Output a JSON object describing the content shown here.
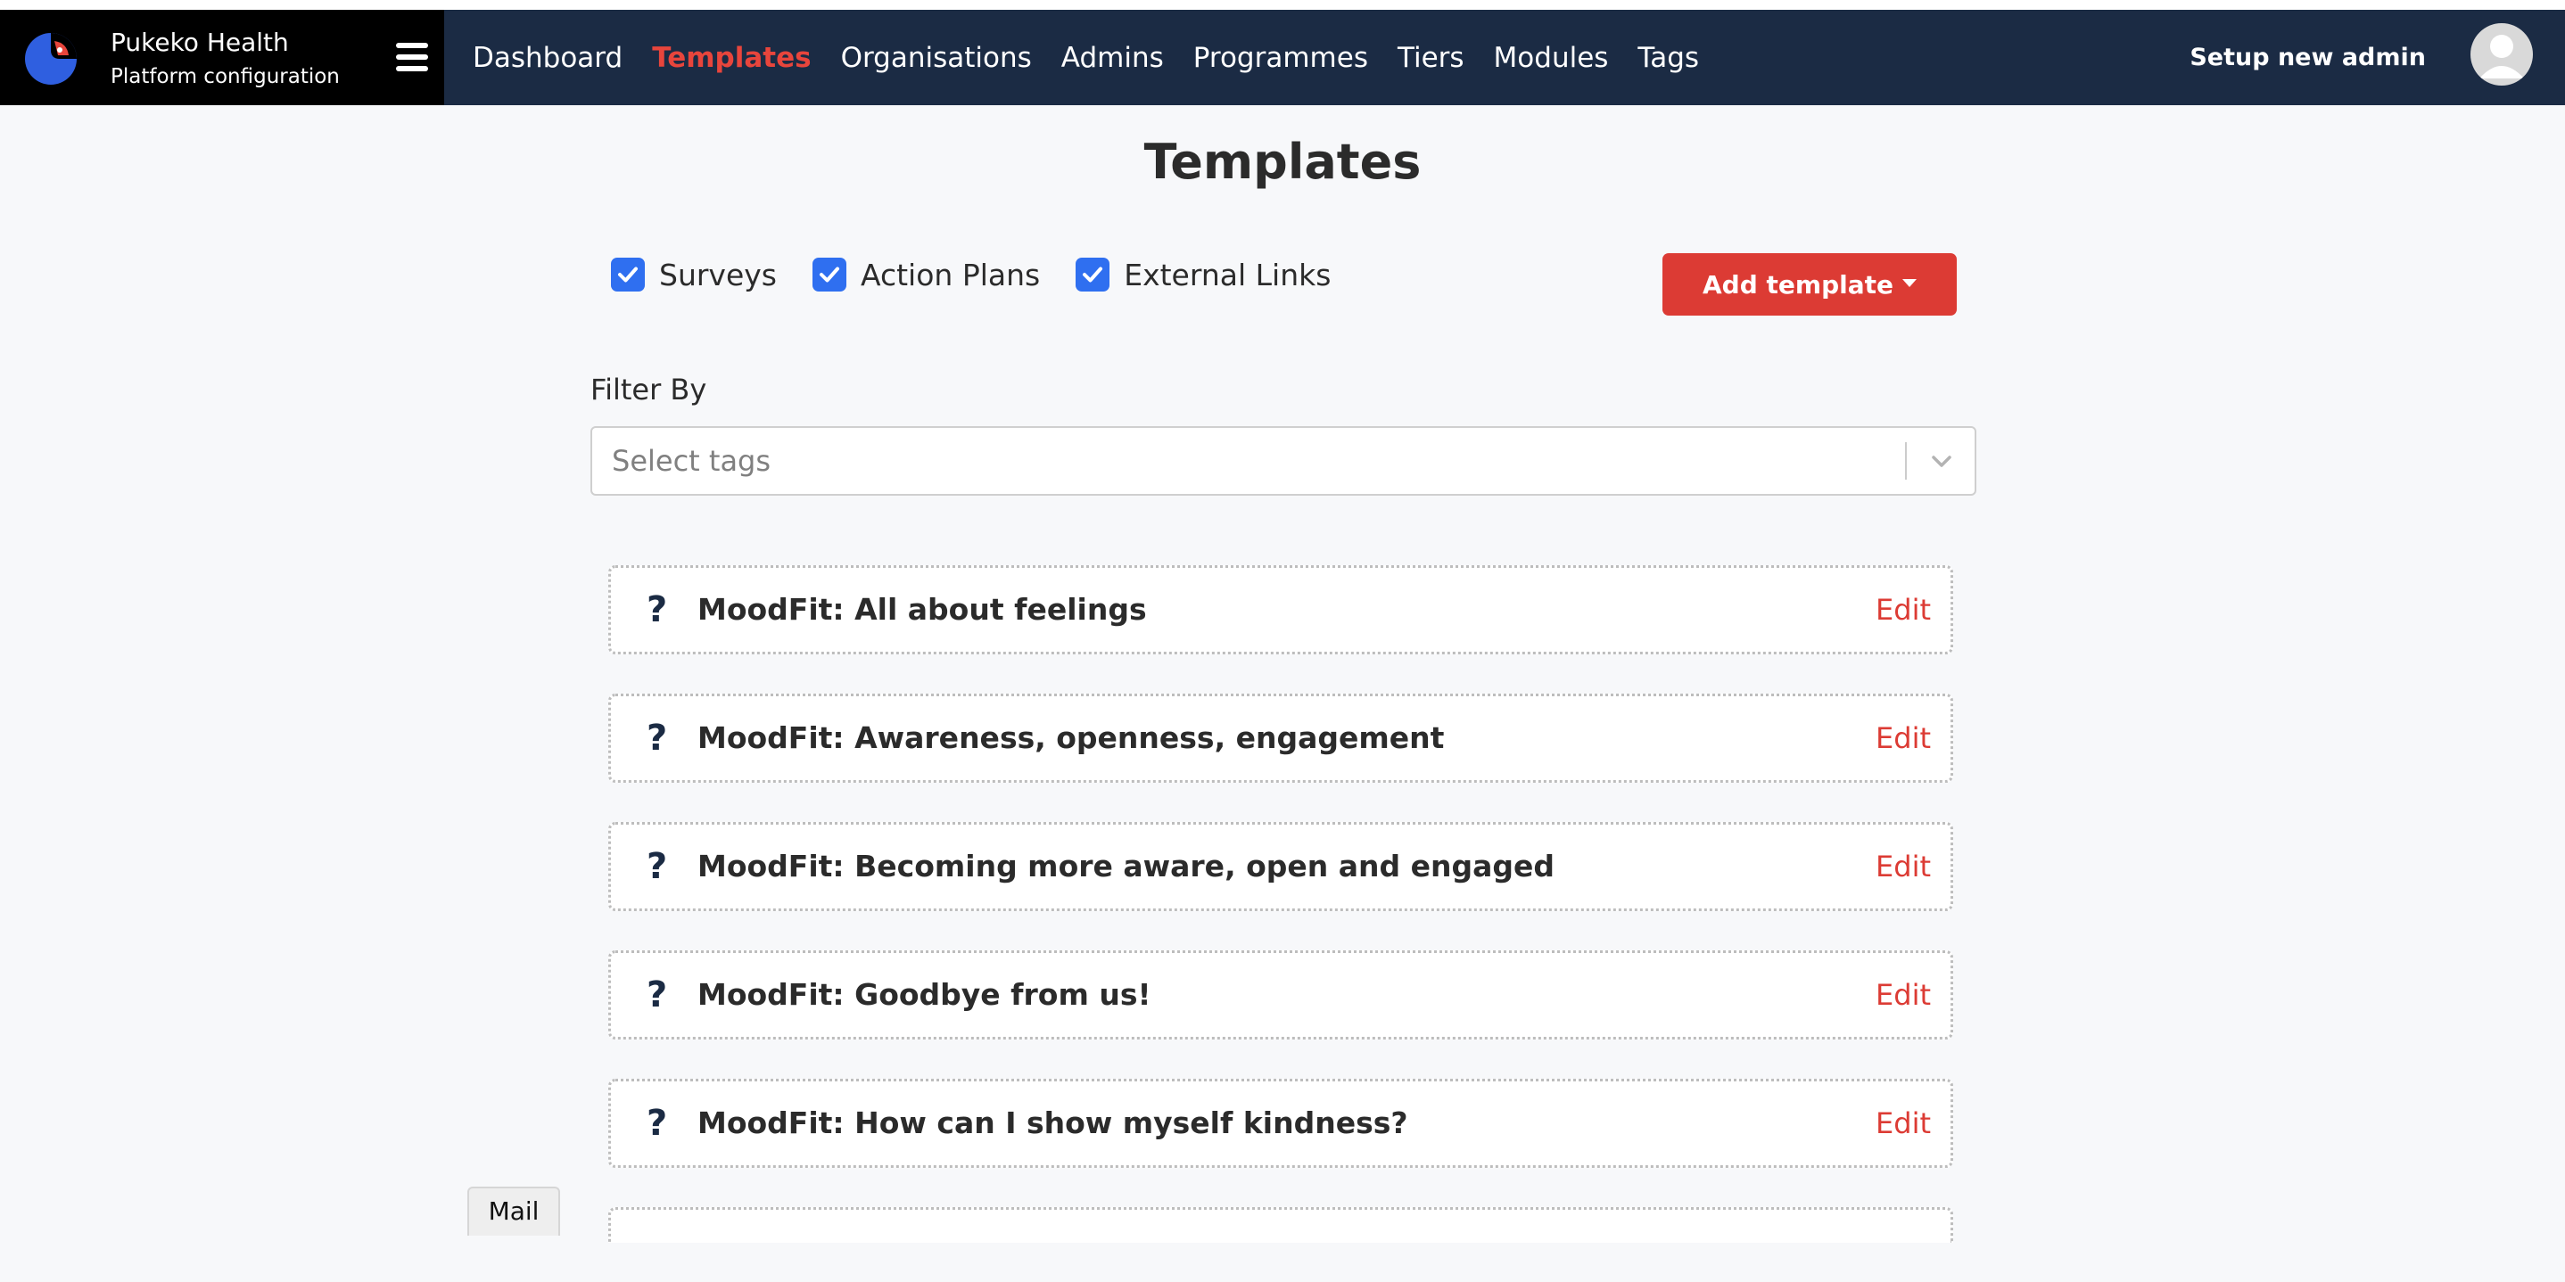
{
  "brand": {
    "name": "Pukeko Health",
    "subtitle": "Platform configuration",
    "logo_icon": "pukeko-logo-icon",
    "menu_icon": "hamburger-menu-icon"
  },
  "nav": {
    "links": [
      {
        "label": "Dashboard",
        "active": false
      },
      {
        "label": "Templates",
        "active": true
      },
      {
        "label": "Organisations",
        "active": false
      },
      {
        "label": "Admins",
        "active": false
      },
      {
        "label": "Programmes",
        "active": false
      },
      {
        "label": "Tiers",
        "active": false
      },
      {
        "label": "Modules",
        "active": false
      },
      {
        "label": "Tags",
        "active": false
      }
    ],
    "setup_admin_label": "Setup new admin",
    "avatar_icon": "user-avatar-icon"
  },
  "page": {
    "title": "Templates"
  },
  "type_filters": [
    {
      "label": "Surveys",
      "checked": true
    },
    {
      "label": "Action Plans",
      "checked": true
    },
    {
      "label": "External Links",
      "checked": true
    }
  ],
  "add_template": {
    "label": "Add template"
  },
  "filter": {
    "label": "Filter By",
    "placeholder": "Select tags"
  },
  "templates": [
    {
      "icon": "?",
      "title": "MoodFit: All about feelings",
      "action": "Edit"
    },
    {
      "icon": "?",
      "title": "MoodFit: Awareness, openness, engagement",
      "action": "Edit"
    },
    {
      "icon": "?",
      "title": "MoodFit: Becoming more aware, open and engaged",
      "action": "Edit"
    },
    {
      "icon": "?",
      "title": "MoodFit: Goodbye from us!",
      "action": "Edit"
    },
    {
      "icon": "?",
      "title": "MoodFit: How can I show myself kindness?",
      "action": "Edit"
    }
  ],
  "mail_button": {
    "label": "Mail"
  },
  "colors": {
    "navbar_bg": "#1b2b44",
    "brand_bg": "#000000",
    "accent_red": "#dc3b34",
    "checkbox_blue": "#2f6ff0"
  }
}
